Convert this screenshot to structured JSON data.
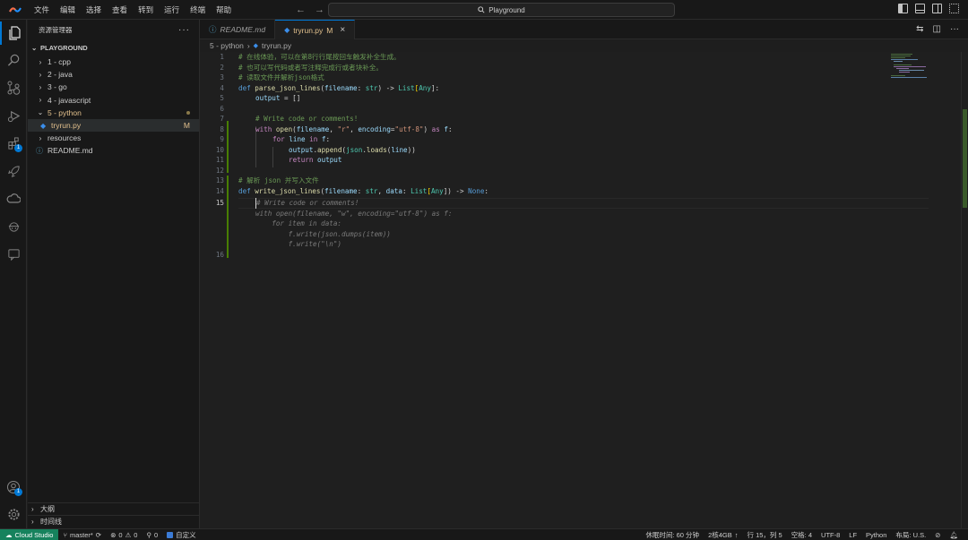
{
  "titlebar": {
    "menu": [
      "文件",
      "编辑",
      "选择",
      "查看",
      "转到",
      "运行",
      "终端",
      "帮助"
    ],
    "search_text": "Playground"
  },
  "activity": {
    "extensions_badge": "1",
    "accounts_badge": "1"
  },
  "sidebar": {
    "header": "资源管理器",
    "section": "PLAYGROUND",
    "items": [
      {
        "label": "1 - cpp"
      },
      {
        "label": "2 - java"
      },
      {
        "label": "3 - go"
      },
      {
        "label": "4 - javascript"
      },
      {
        "label": "5 - python"
      },
      {
        "label": "tryrun.py",
        "status": "M"
      },
      {
        "label": "resources"
      },
      {
        "label": "README.md"
      }
    ],
    "outline": "大纲",
    "timeline": "时间线"
  },
  "tabs": [
    {
      "label": "README.md"
    },
    {
      "label": "tryrun.py",
      "status": "M"
    }
  ],
  "breadcrumb": {
    "folder": "5 - python",
    "file": "tryrun.py"
  },
  "editor": {
    "line_numbers": [
      "1",
      "2",
      "3",
      "4",
      "5",
      "6",
      "7",
      "8",
      "9",
      "10",
      "11",
      "12",
      "13",
      "14",
      "15",
      "16"
    ],
    "l1": "# 在线体验，可以在第8行行尾按回车触发补全生成。",
    "l2": "# 也可以写代码或者写注释完成行或者块补全。",
    "l3": "# 读取文件并解析json格式",
    "l4": {
      "def": "def ",
      "fn": "parse_json_lines",
      "p1": "(",
      "arg": "filename",
      "p2": ": ",
      "ty": "str",
      "p3": ") -> ",
      "ret": "List",
      "p4": "[",
      "ret2": "Any",
      "p5": "]:"
    },
    "l5": {
      "var": "output",
      "rest": " = []"
    },
    "l7": "# Write code or comments!",
    "l8": {
      "kw": "with ",
      "fn": "open",
      "p1": "(",
      "var": "filename",
      "p2": ", ",
      "s1": "\"r\"",
      "p3": ", ",
      "arg": "encoding",
      "p4": "=",
      "s2": "\"utf-8\"",
      "p5": ") ",
      "kw2": "as",
      "p6": " ",
      "f": "f",
      "p7": ":"
    },
    "l9": {
      "kw": "for ",
      "var": "line",
      "kw2": " in ",
      "f": "f",
      "p": ":"
    },
    "l10": {
      "var": "output",
      "p1": ".",
      "fn": "append",
      "p2": "(",
      "mod": "json",
      "p3": ".",
      "fn2": "loads",
      "p4": "(",
      "arg": "line",
      "p5": "))"
    },
    "l11": {
      "kw": "return ",
      "var": "output"
    },
    "l13": "# 解析 json 并写入文件",
    "l14": {
      "def": "def ",
      "fn": "write_json_lines",
      "p1": "(",
      "arg": "filename",
      "p2": ": ",
      "ty": "str",
      "p3": ", ",
      "arg2": "data",
      "p4": ": ",
      "ty2": "List",
      "p5": "[",
      "ty3": "Any",
      "p6": "]) -> ",
      "none": "None",
      "p7": ":"
    },
    "ghost": [
      "# Write code or comments!",
      "with open(filename, \"w\", encoding=\"utf-8\") as f:",
      "    for item in data:",
      "        f.write(json.dumps(item))",
      "        f.write(\"\\n\")"
    ]
  },
  "statusbar": {
    "remote": "Cloud Studio",
    "branch": "master*",
    "errors": "0",
    "warnings": "0",
    "ports": "0",
    "custom": "自定义",
    "rest_time": "休眠时间: 60 分钟",
    "spec": "2核4GB",
    "position": "行 15，列 5",
    "spaces": "空格: 4",
    "encoding": "UTF-8",
    "eol": "LF",
    "language": "Python",
    "layout": "布局: U.S."
  }
}
